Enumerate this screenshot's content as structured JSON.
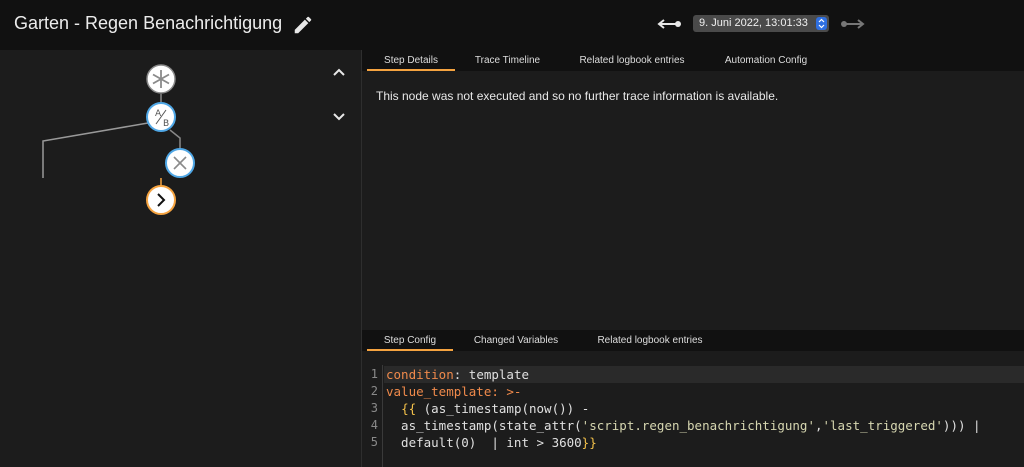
{
  "header": {
    "title": "Garten - Regen Benachrichtigung",
    "trace_selected": "9. Juni 2022, 13:01:33"
  },
  "colors": {
    "accent": "#f5a340",
    "node_blue": "#4fa7e6",
    "select_arrows": "#2f6fe0"
  },
  "graph": {
    "nodes": [
      "trigger-node",
      "choose-node",
      "condition-node",
      "action-node"
    ],
    "choose_label_a": "A",
    "choose_label_b": "B"
  },
  "details_tabs": [
    "Step Details",
    "Trace Timeline",
    "Related logbook entries",
    "Automation Config"
  ],
  "details_message": "This node was not executed and so no further trace information is available.",
  "config_tabs": [
    "Step Config",
    "Changed Variables",
    "Related logbook entries"
  ],
  "code": {
    "line_numbers": [
      "1",
      "2",
      "3",
      "4",
      "5"
    ],
    "l1_key": "condition",
    "l1_colon": ": ",
    "l1_val": "template",
    "l2_key": "value_template",
    "l2_rest": ": >-",
    "l3_indent": "  ",
    "l3_open": "{{",
    "l3_rest": " (as_timestamp(now()) -",
    "l4_pre": "  as_timestamp(state_attr(",
    "l4_s1": "'script.regen_benachrichtigung'",
    "l4_mid": ",",
    "l4_s2": "'last_triggered'",
    "l4_post": "))) |",
    "l5_pre": "  default(0)  | int > 3600",
    "l5_close": "}}"
  }
}
